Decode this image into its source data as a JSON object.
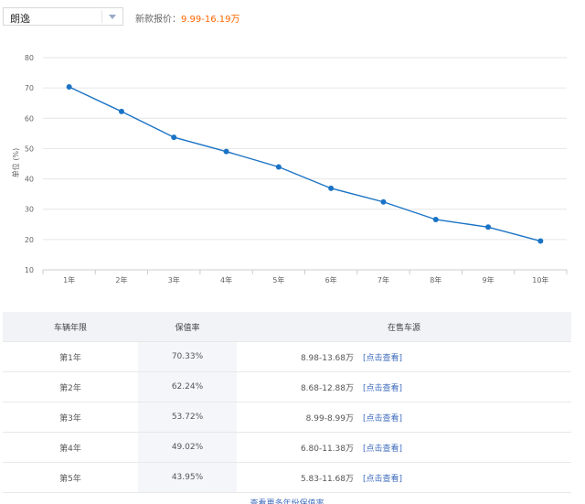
{
  "selector": {
    "value": "朗逸"
  },
  "price": {
    "label": "新款报价：",
    "value": "9.99-16.19万"
  },
  "chart_data": {
    "type": "line",
    "title": "",
    "xlabel": "",
    "ylabel": "单位 (%)",
    "categories": [
      "1年",
      "2年",
      "3年",
      "4年",
      "5年",
      "6年",
      "7年",
      "8年",
      "9年",
      "10年"
    ],
    "series": [
      {
        "values": [
          70.33,
          62.24,
          53.72,
          49.02,
          43.95,
          36.9,
          32.4,
          26.6,
          24.1,
          19.5
        ]
      }
    ],
    "ylim": [
      10,
      80
    ],
    "yticks": [
      10,
      20,
      30,
      40,
      50,
      60,
      70,
      80
    ],
    "grid": true,
    "colors": {
      "line": "#1a73c5",
      "grid": "#e6e6e6"
    }
  },
  "table": {
    "headers": [
      "车辆年限",
      "保值率",
      "在售车源"
    ],
    "rows": [
      {
        "year": "第1年",
        "rate": "70.33%",
        "range": "8.98-13.68万",
        "link": "[点击查看]"
      },
      {
        "year": "第2年",
        "rate": "62.24%",
        "range": "8.68-12.88万",
        "link": "[点击查看]"
      },
      {
        "year": "第3年",
        "rate": "53.72%",
        "range": "8.99-8.99万",
        "link": "[点击查看]"
      },
      {
        "year": "第4年",
        "rate": "49.02%",
        "range": "6.80-11.38万",
        "link": "[点击查看]"
      },
      {
        "year": "第5年",
        "rate": "43.95%",
        "range": "5.83-11.68万",
        "link": "[点击查看]"
      }
    ],
    "more": "查看更多年份保值率"
  }
}
